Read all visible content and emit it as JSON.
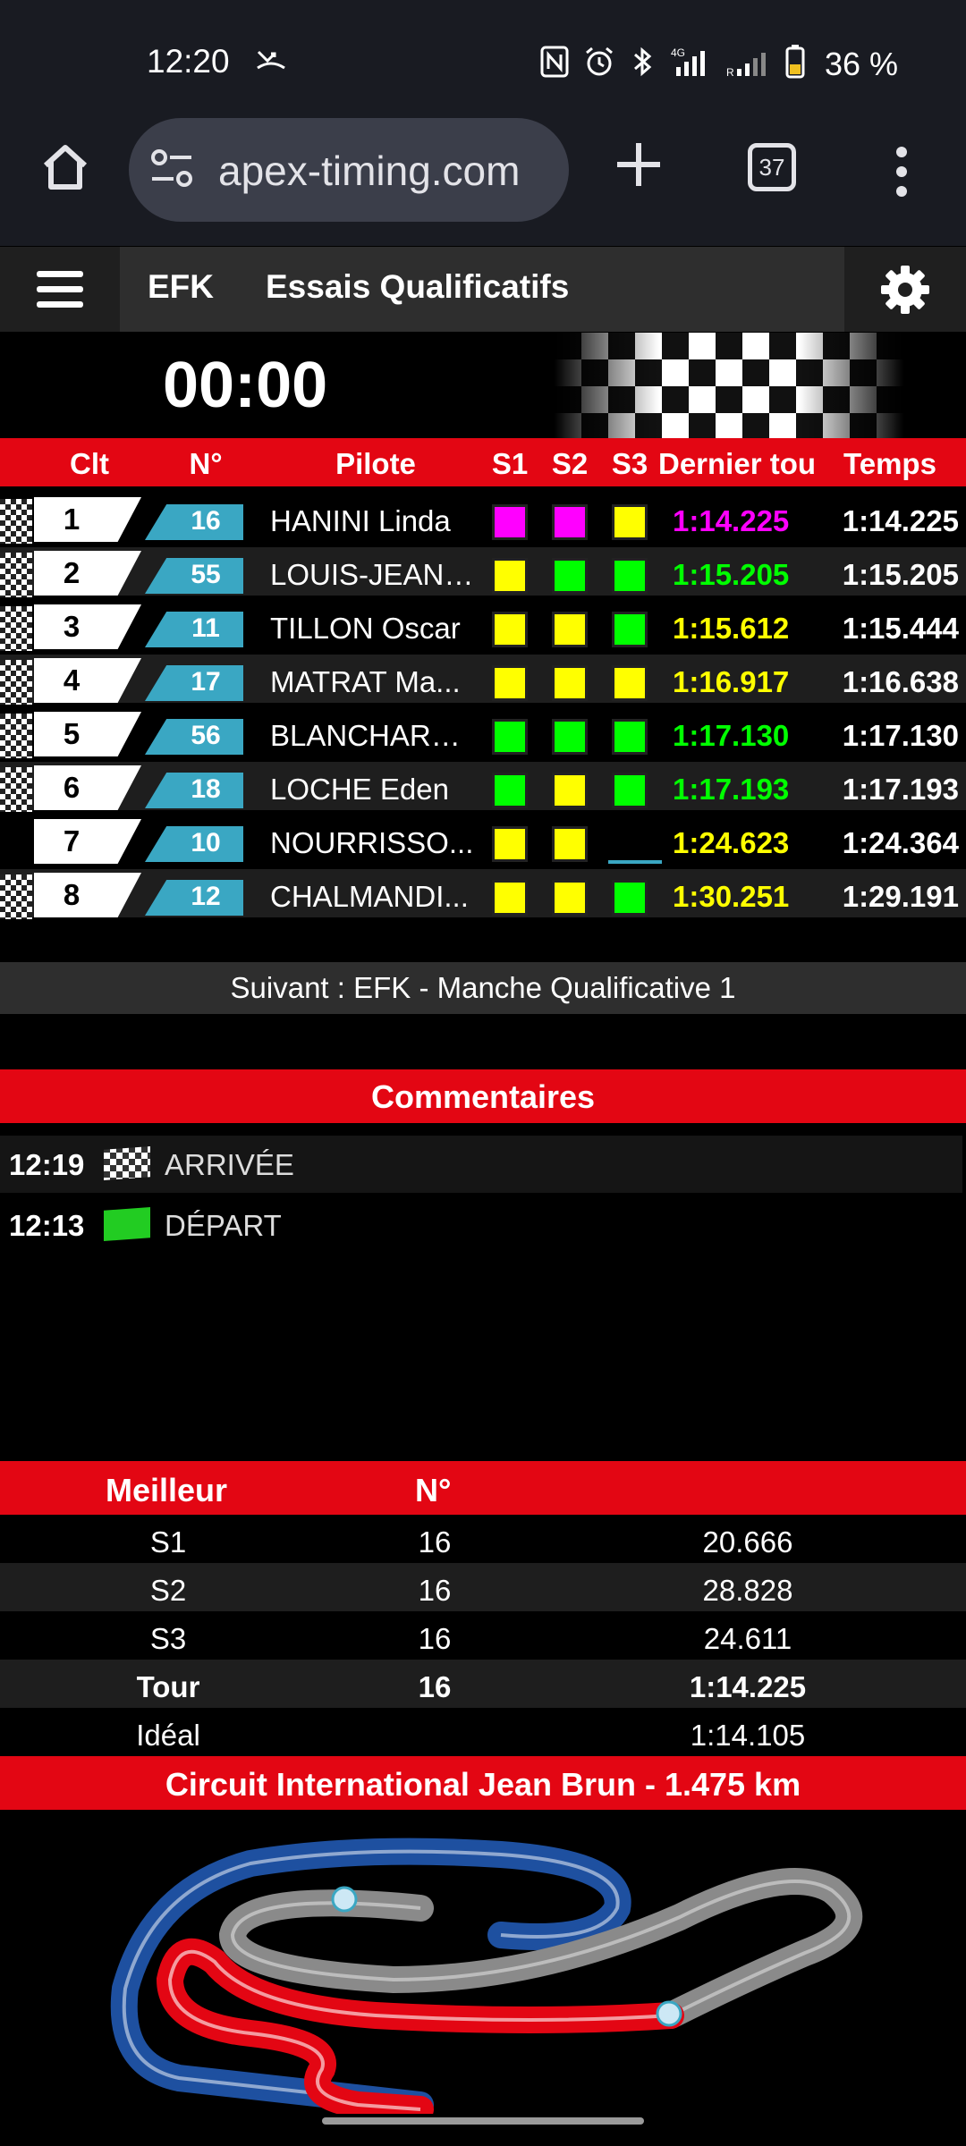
{
  "status_bar": {
    "time": "12:20",
    "battery": "36 %",
    "icons": [
      "missed-call-icon",
      "nfc-icon",
      "alarm-icon",
      "bluetooth-icon",
      "signal-4g-icon",
      "signal-r-icon",
      "battery-icon"
    ]
  },
  "browser": {
    "url": "apex-timing.com",
    "tab_count": "37"
  },
  "site_nav": {
    "brand": "EFK",
    "session": "Essais Qualificatifs"
  },
  "timer": "00:00",
  "table": {
    "headers": {
      "clt": "Clt",
      "num": "N°",
      "pilot": "Pilote",
      "s1": "S1",
      "s2": "S2",
      "s3": "S3",
      "last": "Dernier tou",
      "best": "Temps"
    },
    "rows": [
      {
        "pos": "1",
        "num": "16",
        "pilot": "HANINI Linda",
        "s1": "#ff00ff",
        "s2": "#ff00ff",
        "s3": "#ffff00",
        "last": "1:14.225",
        "last_color": "#ff00ff",
        "best": "1:14.225",
        "checker": true
      },
      {
        "pos": "2",
        "num": "55",
        "pilot": "LOUIS-JEAN ...",
        "s1": "#ffff00",
        "s2": "#00ff00",
        "s3": "#00ff00",
        "last": "1:15.205",
        "last_color": "#00ff00",
        "best": "1:15.205",
        "checker": true
      },
      {
        "pos": "3",
        "num": "11",
        "pilot": "TILLON Oscar",
        "s1": "#ffff00",
        "s2": "#ffff00",
        "s3": "#00ff00",
        "last": "1:15.612",
        "last_color": "#ffff00",
        "best": "1:15.444",
        "checker": true
      },
      {
        "pos": "4",
        "num": "17",
        "pilot": "MATRAT Ma...",
        "s1": "#ffff00",
        "s2": "#ffff00",
        "s3": "#ffff00",
        "last": "1:16.917",
        "last_color": "#ffff00",
        "best": "1:16.638",
        "checker": true
      },
      {
        "pos": "5",
        "num": "56",
        "pilot": "BLANCHARD...",
        "s1": "#00ff00",
        "s2": "#00ff00",
        "s3": "#00ff00",
        "last": "1:17.130",
        "last_color": "#00ff00",
        "best": "1:17.130",
        "checker": true
      },
      {
        "pos": "6",
        "num": "18",
        "pilot": "LOCHE Eden",
        "s1": "#00ff00",
        "s2": "#ffff00",
        "s3": "#00ff00",
        "last": "1:17.193",
        "last_color": "#00ff00",
        "best": "1:17.193",
        "checker": true
      },
      {
        "pos": "7",
        "num": "10",
        "pilot": "NOURRISSO...",
        "s1": "#ffff00",
        "s2": "#ffff00",
        "s3": "",
        "last": "1:24.623",
        "last_color": "#ffff00",
        "best": "1:24.364",
        "checker": false
      },
      {
        "pos": "8",
        "num": "12",
        "pilot": "CHALMANDI...",
        "s1": "#ffff00",
        "s2": "#ffff00",
        "s3": "#00ff00",
        "last": "1:30.251",
        "last_color": "#ffff00",
        "best": "1:29.191",
        "checker": true
      }
    ]
  },
  "next_session": "Suivant : EFK - Manche Qualificative 1",
  "comments": {
    "title": "Commentaires",
    "items": [
      {
        "time": "12:19",
        "flag": "checkered-flag-icon",
        "text": "ARRIVÉE"
      },
      {
        "time": "12:13",
        "flag": "green-flag-icon",
        "text": "DÉPART"
      }
    ]
  },
  "best": {
    "headers": {
      "label": "Meilleur",
      "num": "N°"
    },
    "rows": [
      {
        "label": "S1",
        "num": "16",
        "value": "20.666"
      },
      {
        "label": "S2",
        "num": "16",
        "value": "28.828"
      },
      {
        "label": "S3",
        "num": "16",
        "value": "24.611"
      },
      {
        "label": "Tour",
        "num": "16",
        "value": "1:14.225"
      },
      {
        "label": "Idéal",
        "num": "",
        "value": "1:14.105"
      }
    ]
  },
  "circuit": "Circuit International Jean Brun - 1.475 km",
  "colors": {
    "accent_red": "#e30613",
    "number_blue": "#3aa7c3",
    "best_purple": "#ff00ff",
    "personal_green": "#00ff00",
    "normal_yellow": "#ffff00"
  }
}
